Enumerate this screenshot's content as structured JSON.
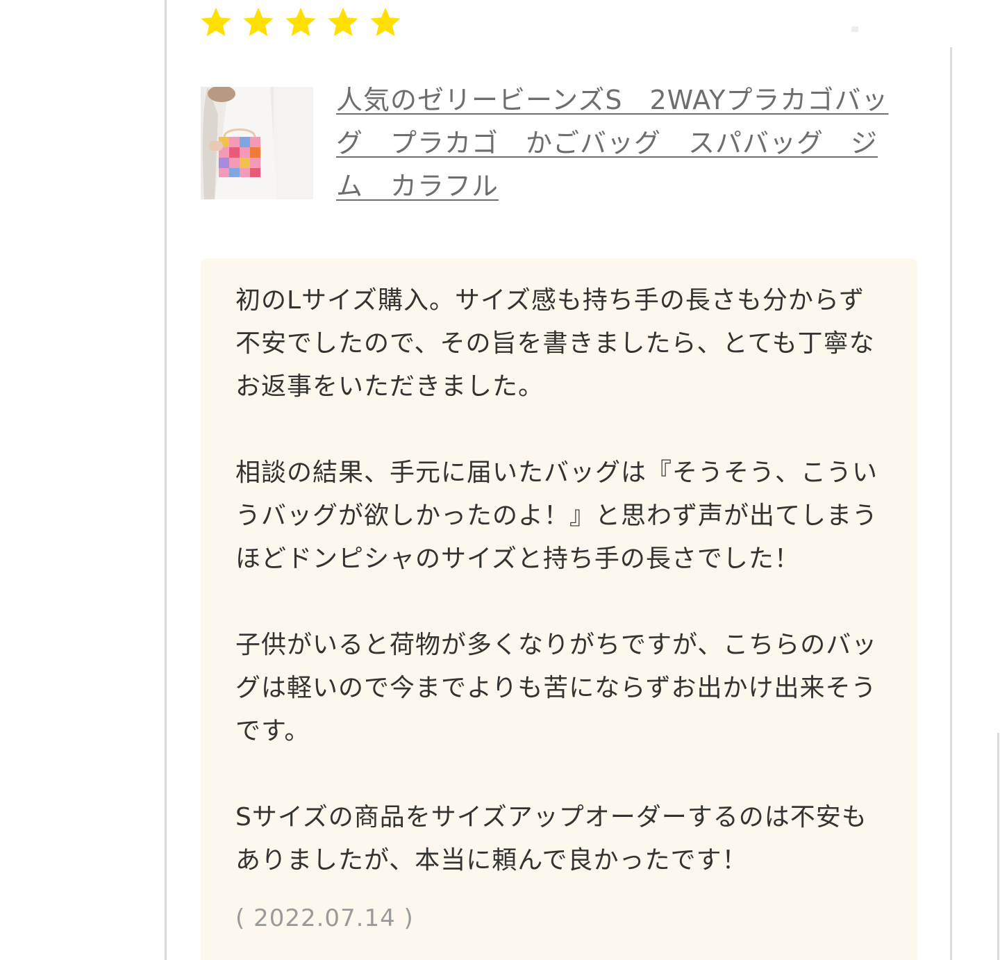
{
  "review": {
    "rating": 5,
    "rating_max": 5,
    "star_color": "#FFE000",
    "product": {
      "image": "product-thumbnail",
      "title": "人気のゼリービーンズS　2WAYプラカゴバッグ　プラカゴ　かごバッグ　スパバッグ　ジム　カラフル"
    },
    "body": [
      "初のLサイズ購入。サイズ感も持ち手の長さも分からず不安でしたので、その旨を書きましたら、とても丁寧なお返事をいただきました。",
      "相談の結果、手元に届いたバッグは『そうそう、こういうバッグが欲しかったのよ！』と思わず声が出てしまうほどドンピシャのサイズと持ち手の長さでした！",
      "子供がいると荷物が多くなりがちですが、こちらのバッグは軽いので今までよりも苦にならずお出かけ出来そうです。",
      "Sサイズの商品をサイズアップオーダーするのは不安もありましたが、本当に頼んで良かったです！"
    ],
    "date": "( 2022.07.14 )",
    "box_color": "#fcf8ed"
  }
}
